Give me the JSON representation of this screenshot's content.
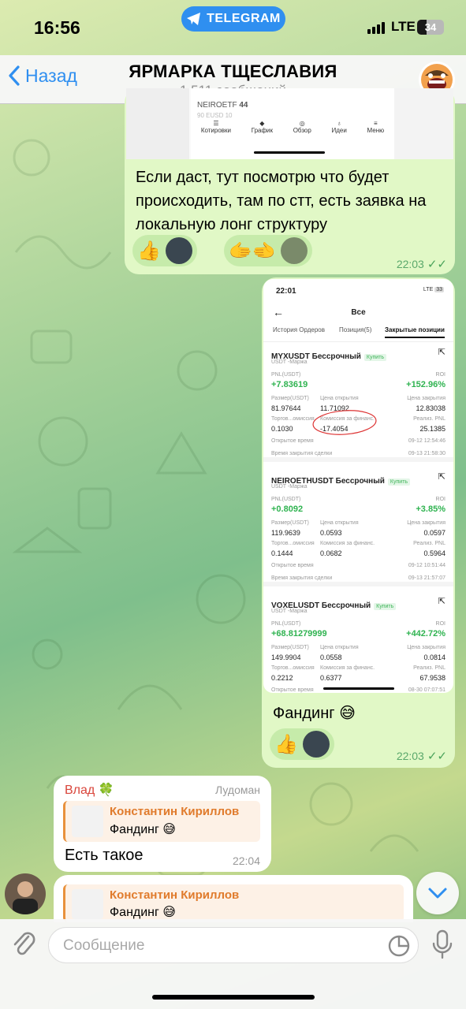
{
  "status": {
    "time": "16:56",
    "app_pill": "TELEGRAM",
    "network": "LTE",
    "battery": "34",
    "battery_level": 0.34
  },
  "header": {
    "back_label": "Назад",
    "title": "ЯРМАРКА ТЩЕСЛАВИЯ",
    "subtitle": "1 511 сообщений"
  },
  "msg1": {
    "shot_row1_ticker": "NEIROETF",
    "shot_row1_val": "44",
    "shot_row2": "90 EUSD",
    "shot_row2_val": "10",
    "nav": [
      "Котировки",
      "График",
      "Обзор",
      "Идеи",
      "Меню"
    ],
    "text": "Если даст, тут посмотрю что будет происходить, там по стт, есть заявка на локальную лонг структуру",
    "reactions": [
      "👍",
      "🫱‍🫲"
    ],
    "time": "22:03"
  },
  "msg2": {
    "shot": {
      "time": "22:01",
      "network": "LTE",
      "battery": "33",
      "title": "Все",
      "tabs": [
        "История Ордеров",
        "Позиция(5)",
        "Закрытые позиции"
      ],
      "buy": "Купить",
      "labels": {
        "pnl": "PNL(USDT)",
        "roi": "ROI",
        "size": "Размер(USDT)",
        "open": "Цена открытия",
        "close": "Цена закрытия",
        "fee": "Торгов...омиссия",
        "funding": "Комиссия за финанс.",
        "realized": "Реализ. PNL",
        "opened": "Открытое время",
        "closed": "Время закрытия сделки"
      },
      "positions": [
        {
          "symbol": "MYXUSDT Бессрочный",
          "sub": "USDT -Маржа",
          "pnl": "+7.83619",
          "roi": "+152.96%",
          "size": "81.97644",
          "open": "11.71092",
          "close": "12.83038",
          "fee": "0.1030",
          "funding": "-17.4054",
          "realized": "25.1385",
          "opened": "09-12 12:54:46",
          "closed": "09-13 21:58:30"
        },
        {
          "symbol": "NEIROETHUSDT Бессрочный",
          "sub": "USDT -Маржа",
          "pnl": "+0.8092",
          "roi": "+3.85%",
          "size": "119.9639",
          "open": "0.0593",
          "close": "0.0597",
          "fee": "0.1444",
          "funding": "0.0682",
          "realized": "0.5964",
          "opened": "09-12 10:51:44",
          "closed": "09-13 21:57:07"
        },
        {
          "symbol": "VOXELUSDT Бессрочный",
          "sub": "USDT -Маржа",
          "pnl": "+68.81279999",
          "roi": "+442.72%",
          "size": "149.9904",
          "open": "0.0558",
          "close": "0.0814",
          "fee": "0.2212",
          "funding": "0.6377",
          "realized": "67.9538",
          "opened": "08-30 07:07:51",
          "closed": ""
        }
      ]
    },
    "text": "Фандинг 😅",
    "reactions": [
      "👍"
    ],
    "time": "22:03"
  },
  "msg3": {
    "author": "Влад",
    "author_badge": "🍀",
    "rank": "Лудоман",
    "reply_author": "Константин Кириллов",
    "reply_text": "Фандинг 😅",
    "text": "Есть такое",
    "time": "22:04"
  },
  "msg4": {
    "reply_author": "Константин Кириллов",
    "reply_text": "Фандинг 😅"
  },
  "composer": {
    "placeholder": "Сообщение"
  },
  "colors": {
    "accent": "#2f8ff0",
    "outgoing": "#e1f8c6",
    "positive": "#2fb350",
    "reply_accent": "#e8913c"
  }
}
